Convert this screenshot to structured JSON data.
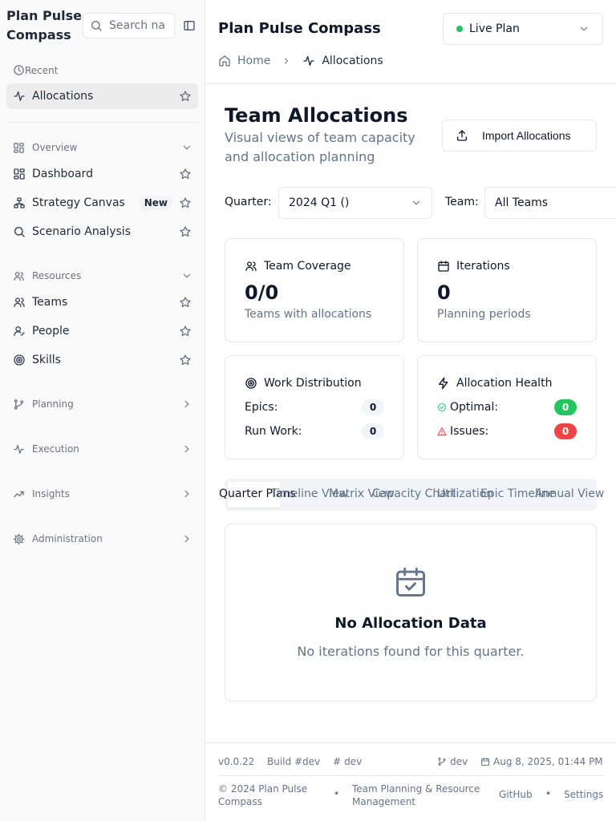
{
  "sidebar": {
    "brand": "Plan Pulse Compass",
    "search_placeholder": "Search na",
    "recent_label": "Recent",
    "recent_items": [
      {
        "label": "Allocations",
        "icon": "activity-icon"
      }
    ],
    "sections": [
      {
        "label": "Overview",
        "icon": "overview-icon",
        "expanded": true,
        "items": [
          {
            "label": "Dashboard",
            "icon": "dashboard-icon"
          },
          {
            "label": "Strategy Canvas",
            "icon": "strategy-icon",
            "badge": "New"
          },
          {
            "label": "Scenario Analysis",
            "icon": "search-icon"
          }
        ]
      },
      {
        "label": "Resources",
        "icon": "users-icon",
        "expanded": true,
        "items": [
          {
            "label": "Teams",
            "icon": "users-icon"
          },
          {
            "label": "People",
            "icon": "person-icon"
          },
          {
            "label": "Skills",
            "icon": "target-icon"
          }
        ]
      },
      {
        "label": "Planning",
        "icon": "branch-icon",
        "expanded": false
      },
      {
        "label": "Execution",
        "icon": "activity-icon",
        "expanded": false
      },
      {
        "label": "Insights",
        "icon": "trend-icon",
        "expanded": false
      },
      {
        "label": "Administration",
        "icon": "gear-icon",
        "expanded": false
      }
    ]
  },
  "header": {
    "app_title": "Plan Pulse Compass",
    "plan_select": "Live Plan",
    "plan_status_color": "#22c55e",
    "breadcrumb": {
      "home": "Home",
      "current": "Allocations"
    }
  },
  "page": {
    "title": "Team Allocations",
    "subtitle": "Visual views of team capacity and allocation planning",
    "import_button": "Import Allocations"
  },
  "filters": {
    "quarter_label": "Quarter:",
    "quarter_value": "2024 Q1 ()",
    "team_label": "Team:",
    "team_value": "All Teams"
  },
  "cards": {
    "coverage": {
      "title": "Team Coverage",
      "value": "0/0",
      "desc": "Teams with allocations"
    },
    "iterations": {
      "title": "Iterations",
      "value": "0",
      "desc": "Planning periods"
    },
    "distribution": {
      "title": "Work Distribution",
      "rows": [
        {
          "label": "Epics:",
          "value": "0"
        },
        {
          "label": "Run Work:",
          "value": "0"
        }
      ]
    },
    "health": {
      "title": "Allocation Health",
      "rows": [
        {
          "label": "Optimal:",
          "value": "0",
          "color": "#22c55e"
        },
        {
          "label": "Issues:",
          "value": "0",
          "color": "#ef4444"
        }
      ]
    }
  },
  "tabs": [
    "Quarter Plans",
    "Timeline View",
    "Matrix View",
    "Capacity Chart",
    "Utilization",
    "Epic Timeline",
    "Annual View"
  ],
  "active_tab": "Quarter Plans",
  "empty_state": {
    "title": "No Allocation Data",
    "message": "No iterations found for this quarter."
  },
  "footer": {
    "version": "v0.0.22",
    "build": "Build #dev",
    "hash": "dev",
    "branch": "dev",
    "date": "Aug 8, 2025, 01:44 PM",
    "copyright": "© 2024 Plan Pulse Compass",
    "tagline": "Team Planning & Resource Management",
    "github": "GitHub",
    "settings": "Settings",
    "separator": "•"
  }
}
